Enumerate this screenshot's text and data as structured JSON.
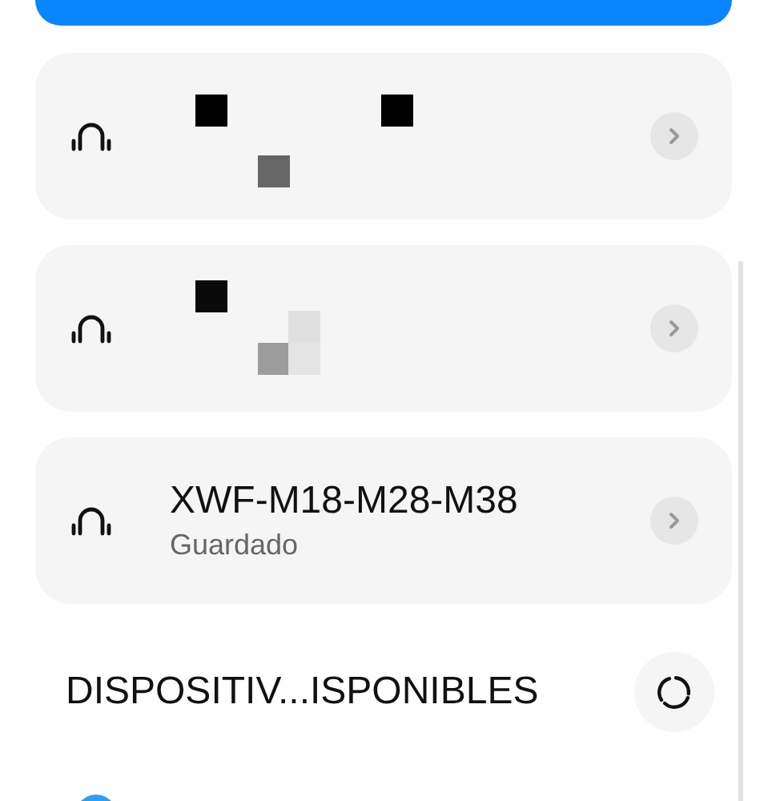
{
  "top_button": {
    "kind": "button"
  },
  "devices": [
    {
      "kind": "redacted"
    },
    {
      "kind": "redacted"
    },
    {
      "kind": "named",
      "name": "XWF-M18-M28-M38",
      "status": "Guardado"
    }
  ],
  "available_section": {
    "title": "DISPOSITIV...ISPONIBLES"
  }
}
